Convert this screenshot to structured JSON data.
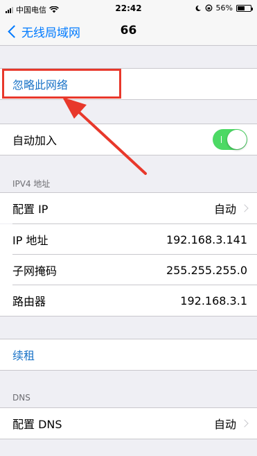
{
  "status": {
    "carrier": "中国电信",
    "time": "22:42",
    "battery": "56%",
    "battery_level": 0.56
  },
  "nav": {
    "back_label": "无线局域网",
    "title": "66"
  },
  "forget_network": "忽略此网络",
  "auto_join": {
    "label": "自动加入",
    "enabled": true
  },
  "ipv4": {
    "header": "IPV4 地址",
    "rows": [
      {
        "label": "配置 IP",
        "value": "自动"
      },
      {
        "label": "IP 地址",
        "value": "192.168.3.141"
      },
      {
        "label": "子网掩码",
        "value": "255.255.255.0"
      },
      {
        "label": "路由器",
        "value": "192.168.3.1"
      }
    ]
  },
  "renew_lease": "续租",
  "dns": {
    "header": "DNS",
    "configure_label": "配置 DNS",
    "configure_value": "自动"
  },
  "colors": {
    "accent": "#007aff",
    "link": "#1a73c7",
    "toggle_on": "#4cd964",
    "annotation": "#e8382b"
  }
}
